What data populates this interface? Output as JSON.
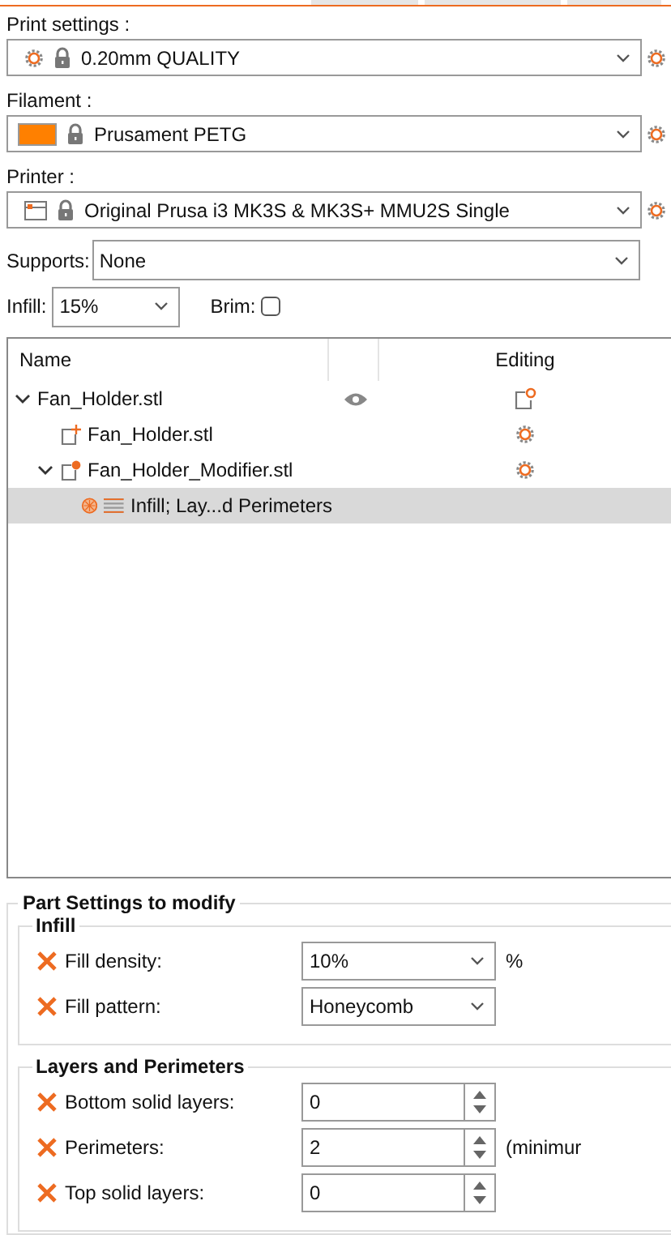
{
  "presets": [
    {
      "label": "Print settings :",
      "kind": "print",
      "value": "0.20mm QUALITY"
    },
    {
      "label": "Filament :",
      "kind": "filament",
      "value": "Prusament PETG",
      "color": "#ff8000"
    },
    {
      "label": "Printer :",
      "kind": "printer",
      "value": "Original Prusa i3 MK3S & MK3S+ MMU2S Single"
    }
  ],
  "supports": {
    "label": "Supports:",
    "value": "None"
  },
  "infill": {
    "label": "Infill:",
    "value": "15%"
  },
  "brim": {
    "label": "Brim:",
    "checked": false
  },
  "tree": {
    "columns": [
      "Name",
      "Editing"
    ],
    "items": [
      {
        "name": "Fan_Holder.stl",
        "kind": "object",
        "expanded": true,
        "visible": true,
        "selected": false,
        "children": [
          {
            "name": "Fan_Holder.stl",
            "kind": "part",
            "selected": false
          },
          {
            "name": "Fan_Holder_Modifier.stl",
            "kind": "modifier",
            "expanded": true,
            "selected": false,
            "children": [
              {
                "name": "Infill; Lay...d Perimeters",
                "kind": "settings",
                "selected": true
              }
            ]
          }
        ]
      }
    ]
  },
  "part_settings": {
    "title": "Part Settings to modify",
    "groups": [
      {
        "title": "Infill",
        "options": [
          {
            "label": "Fill density:",
            "kind": "combo",
            "value": "10%",
            "unit": "%"
          },
          {
            "label": "Fill pattern:",
            "kind": "combo",
            "value": "Honeycomb"
          }
        ]
      },
      {
        "title": "Layers and Perimeters",
        "options": [
          {
            "label": "Bottom solid layers:",
            "kind": "spin",
            "value": "0"
          },
          {
            "label": "Perimeters:",
            "kind": "spin",
            "value": "2",
            "unit": "(minimur"
          },
          {
            "label": "Top solid layers:",
            "kind": "spin",
            "value": "0"
          }
        ]
      }
    ]
  }
}
